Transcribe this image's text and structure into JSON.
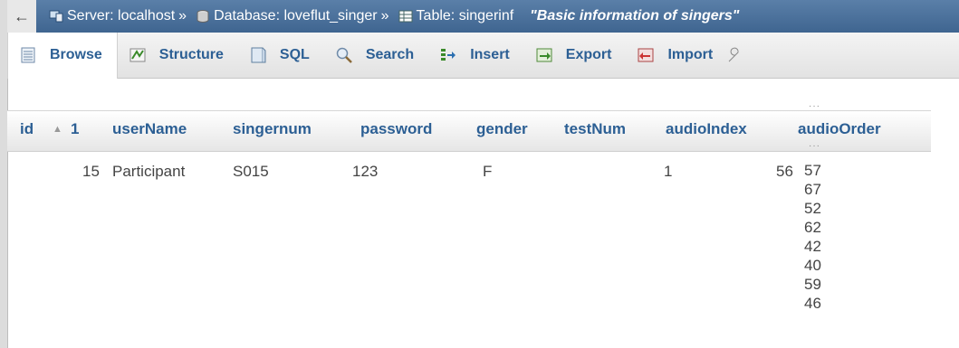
{
  "breadcrumb": {
    "back": "←",
    "server_label": "Server: localhost",
    "sep1": "»",
    "database_label": "Database: loveflut_singer",
    "sep2": "»",
    "table_label": "Table: singerinf",
    "comment": "\"Basic information of singers\""
  },
  "tabs": [
    {
      "label": "Browse",
      "icon": "browse-icon"
    },
    {
      "label": "Structure",
      "icon": "structure-icon"
    },
    {
      "label": "SQL",
      "icon": "sql-icon"
    },
    {
      "label": "Search",
      "icon": "search-icon"
    },
    {
      "label": "Insert",
      "icon": "insert-icon"
    },
    {
      "label": "Export",
      "icon": "export-icon"
    },
    {
      "label": "Import",
      "icon": "import-icon"
    }
  ],
  "table": {
    "headers": {
      "id": "id",
      "sort_num": "1",
      "userName": "userName",
      "singernum": "singernum",
      "password": "password",
      "gender": "gender",
      "testNum": "testNum",
      "audioIndex": "audioIndex",
      "audioOrder": "audioOrder"
    },
    "row": {
      "id": "15",
      "userName": "Participant",
      "singernum": "S015",
      "password": "123",
      "gender": "F",
      "testNum": "",
      "audioIndex": "1",
      "audioIndex_extra": "56",
      "audioOrder": [
        "57",
        "67",
        "52",
        "62",
        "42",
        "40",
        "59",
        "46"
      ]
    }
  },
  "colors": {
    "breadcrumb_bg": "#4a719c",
    "link_blue": "#2c5f94",
    "cell_text": "#444444"
  }
}
